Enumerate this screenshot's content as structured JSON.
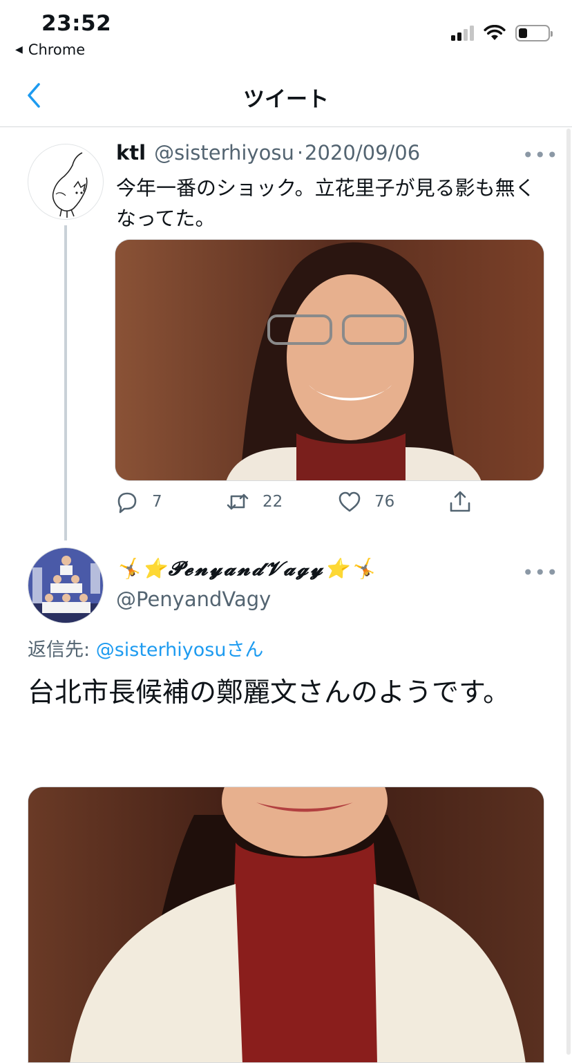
{
  "status_bar": {
    "time": "23:52",
    "back_app": "Chrome",
    "back_glyph": "◀"
  },
  "nav": {
    "title": "ツイート"
  },
  "tweet1": {
    "name": "ktl",
    "handle": "@sisterhiyosu",
    "separator": "·",
    "date": "2020/09/06",
    "more": "•••",
    "text": "今年一番のショック。立花里子が見る影も無くなってた。",
    "media_icon": "photo-woman-glasses",
    "actions": {
      "reply_count": "7",
      "retweet_count": "22",
      "like_count": "76"
    }
  },
  "tweet2": {
    "name": "🤸⭐𝓟𝓮𝓷𝔂𝓪𝓷𝓭𝓥𝓪𝓰𝔂⭐🤸",
    "handle": "@PenyandVagy",
    "more": "•••",
    "reply_label": "返信先: ",
    "reply_link": "@sisterhiyosu",
    "reply_suffix": "さん",
    "text": "台北市長候補の鄭麗文さんのようです。",
    "media_icon": "photo-woman-red-turtleneck"
  },
  "colors": {
    "accent": "#1d9bf0",
    "secondary_text": "#536471",
    "divider": "#d5d8db"
  }
}
